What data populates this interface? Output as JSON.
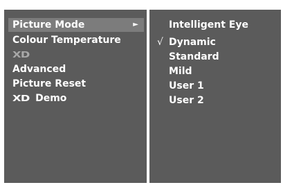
{
  "menu": {
    "items": [
      {
        "label": "Picture Mode",
        "arrow": "►"
      },
      {
        "label": "Colour Temperature"
      },
      {
        "label": "XD"
      },
      {
        "label": "Advanced"
      },
      {
        "label": "Picture Reset"
      },
      {
        "logo": "XD",
        "label": "Demo"
      }
    ]
  },
  "submenu": {
    "header": "Intelligent Eye",
    "check": "√",
    "options": [
      "Dynamic",
      "Standard",
      "Mild",
      "User 1",
      "User 2"
    ]
  },
  "colors": {
    "panel": "#5b5b5b",
    "highlight": "#7c7c7c",
    "text": "#ffffff",
    "disabled": "#a9a9a9"
  }
}
